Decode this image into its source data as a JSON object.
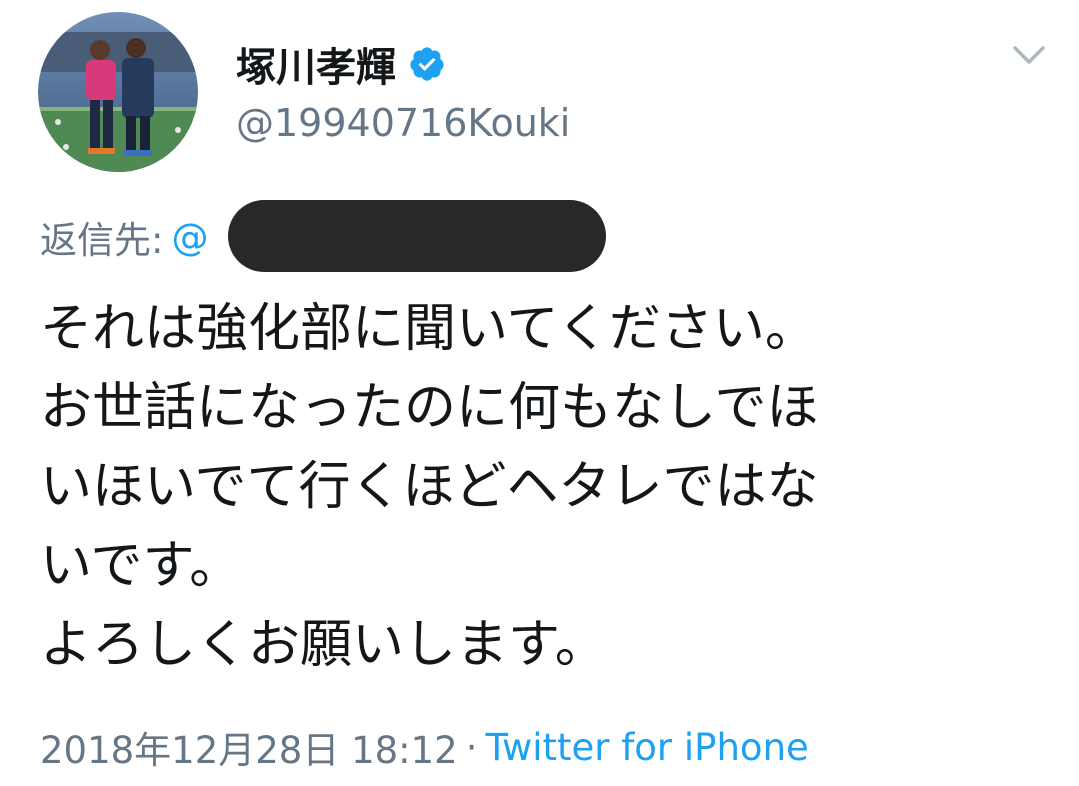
{
  "user": {
    "display_name": "塚川孝輝",
    "handle": "@19940716Kouki",
    "avatar_icon": "profile-photo",
    "verified_icon": "verified-badge-icon",
    "verified_color": "#1da1f2"
  },
  "menu": {
    "icon": "chevron-down-icon"
  },
  "reply": {
    "label": "返信先:",
    "mention_prefix": "@"
  },
  "tweet": {
    "lines": [
      "それは強化部に聞いてください。",
      "お世話になったのに何もなしでほ",
      "いほいでて行くほどヘタレではな",
      "いです。",
      "よろしくお願いします。"
    ]
  },
  "meta": {
    "timestamp": "2018年12月28日 18:12",
    "separator": "·",
    "source": "Twitter for iPhone"
  },
  "colors": {
    "text": "#14171a",
    "secondary": "#657786",
    "link": "#1da1f2"
  }
}
